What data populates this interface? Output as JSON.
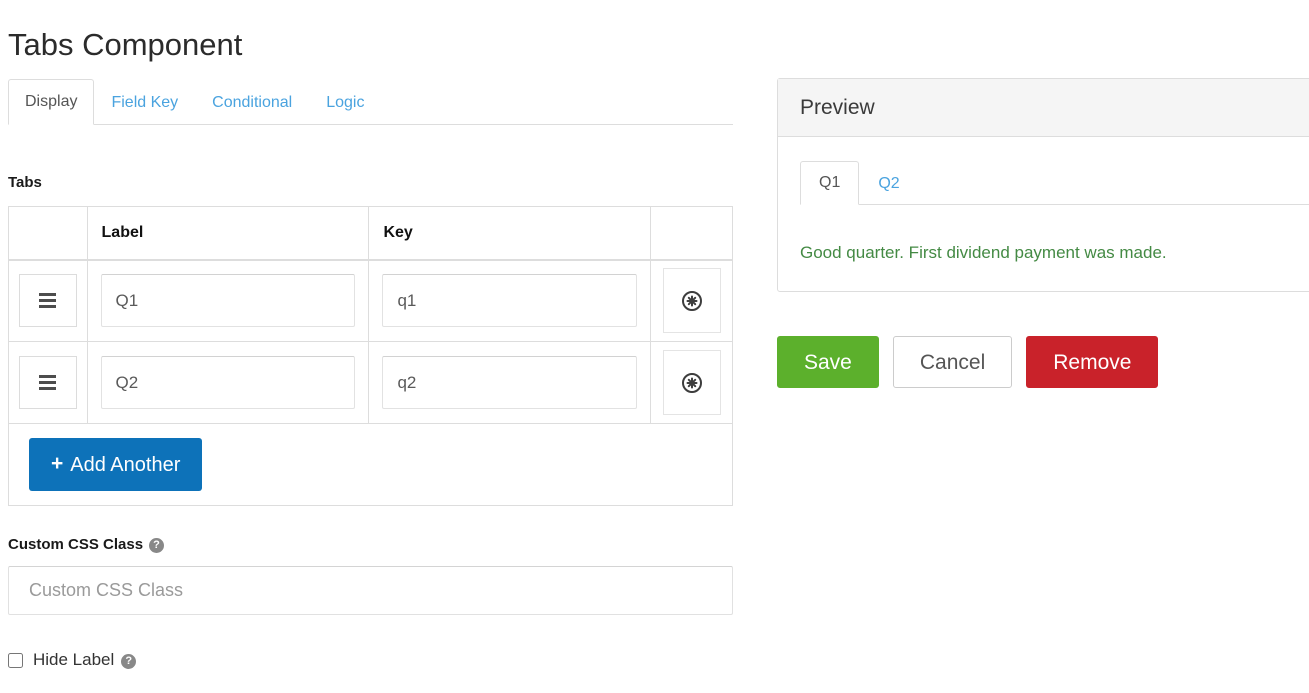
{
  "page_title": "Tabs Component",
  "colors": {
    "link_blue": "#4aa3df",
    "add_blue": "#0d72b9",
    "save_green": "#5cb02c",
    "remove_red": "#c9222a",
    "preview_text_green": "#448a44",
    "panel_header_bg": "#f5f5f5",
    "border_gray": "#dddddd"
  },
  "nav_tabs": [
    {
      "label": "Display",
      "active": true
    },
    {
      "label": "Field Key",
      "active": false
    },
    {
      "label": "Conditional",
      "active": false
    },
    {
      "label": "Logic",
      "active": false
    }
  ],
  "tabs_section": {
    "label": "Tabs",
    "columns": [
      "",
      "Label",
      "Key",
      ""
    ],
    "rows": [
      {
        "handle_icon": "drag-handle-icon",
        "label_value": "Q1",
        "key_value": "q1",
        "remove_icon": "remove-circle-icon"
      },
      {
        "handle_icon": "drag-handle-icon",
        "label_value": "Q2",
        "key_value": "q2",
        "remove_icon": "remove-circle-icon"
      }
    ],
    "add_button": {
      "label": "Add Another",
      "icon": "plus-icon",
      "glyph": "+"
    }
  },
  "custom_css": {
    "label": "Custom CSS Class",
    "help_icon": "help-icon",
    "help_glyph": "?",
    "placeholder": "Custom CSS Class",
    "value": ""
  },
  "hide_label": {
    "label": "Hide Label",
    "checked": false,
    "help_icon": "help-icon",
    "help_glyph": "?"
  },
  "preview": {
    "title": "Preview",
    "tabs": [
      {
        "label": "Q1",
        "active": true
      },
      {
        "label": "Q2",
        "active": false
      }
    ],
    "content": "Good quarter. First dividend payment was made."
  },
  "actions": {
    "save_label": "Save",
    "cancel_label": "Cancel",
    "remove_label": "Remove"
  }
}
